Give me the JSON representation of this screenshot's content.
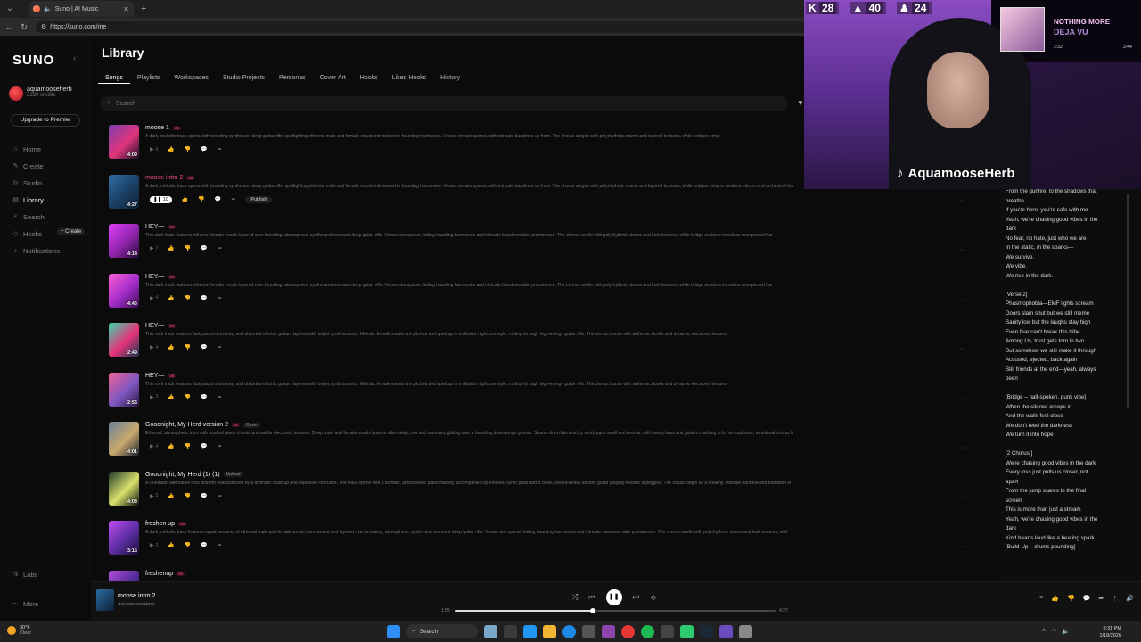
{
  "browser": {
    "tab_title": "Suno | AI Music",
    "url": "https://suno.com/me"
  },
  "sidebar": {
    "logo": "SUNO",
    "user_name": "aquamooseherb",
    "credits": "2230 credits",
    "upgrade_label": "Upgrade to Premier",
    "nav": [
      {
        "label": "Home",
        "icon": "home-icon"
      },
      {
        "label": "Create",
        "icon": "create-icon"
      },
      {
        "label": "Studio",
        "icon": "studio-icon"
      },
      {
        "label": "Library",
        "icon": "library-icon"
      },
      {
        "label": "Search",
        "icon": "search-icon"
      },
      {
        "label": "Hooks",
        "icon": "hooks-icon"
      },
      {
        "label": "Notifications",
        "icon": "bell-icon"
      }
    ],
    "create_pill": "+ Create",
    "labs": "Labs",
    "more": "More"
  },
  "library": {
    "title": "Library",
    "tabs": [
      "Songs",
      "Playlists",
      "Workspaces",
      "Studio Projects",
      "Personas",
      "Cover Art",
      "Hooks",
      "Liked Hooks",
      "History"
    ],
    "search_placeholder": "Search",
    "publish_label": "Publish",
    "songs": [
      {
        "title": "moose 1",
        "badge": "v5",
        "tag": "",
        "duration": "4:09",
        "plays": "8",
        "desc": "A dark, melodic track opens with brooding synths and deep guitar riffs, spotlighting ethereal male and female vocals intertwined in haunting harmonies. Verses remain sparse, with intricate basslines up front. The chorus surges with polyrhythmic drums and layered textures, while bridges bring",
        "colors": [
          "#7a3fb0",
          "#e0357a",
          "#1b0f2d"
        ]
      },
      {
        "title": "moose intro 2",
        "badge": "v5",
        "tag": "",
        "duration": "4:27",
        "plays": "10",
        "desc": "A dark, melodic track opens with brooding synths and deep guitar riffs, spotlighting ethereal male and female vocals intertwined in haunting harmonies. Verses remain sparse, with intricate basslines up front. The chorus surges with polyrhythmic drums and layered textures, while bridges bring in ambient electro and orchestral hits",
        "colors": [
          "#2d6da3",
          "#1b3f63",
          "#0d2034"
        ]
      },
      {
        "title": "HEY—",
        "badge": "v5",
        "tag": "",
        "duration": "4:14",
        "plays": "7",
        "desc": "This dark track features ethereal female vocals layered over brooding, atmospheric synths and resonant deep guitar riffs. Verses are sparse, letting haunting harmonies and intricate basslines take prominence. The chorus swells with polyrhythmic drums and lush textures, while bridge sections introduce unexpected har",
        "colors": [
          "#e040fb",
          "#8e24aa",
          "#2a0a3a"
        ]
      },
      {
        "title": "HEY—",
        "badge": "v5",
        "tag": "",
        "duration": "4:45",
        "plays": "4",
        "desc": "This dark track features ethereal female vocals layered over brooding, atmospheric synths and resonant deep guitar riffs. Verses are sparse, letting haunting harmonies and intricate basslines take prominence. The chorus swells with polyrhythmic drums and lush textures, while bridge sections introduce unexpected har",
        "colors": [
          "#ff5ed8",
          "#a02cc8",
          "#3a0c50"
        ]
      },
      {
        "title": "HEY—",
        "badge": "v5",
        "tag": "",
        "duration": "2:49",
        "plays": "4",
        "desc": "This rock track features fast-paced drumming and distorted electric guitars layered with bright synth accents. Melodic female vocals are pitched and sped up in a distinct nightcore style, cutting through high-energy guitar riffs. The chorus bursts with anthemic hooks and dynamic electronic textures",
        "colors": [
          "#38d9a9",
          "#e6337a",
          "#183a52"
        ]
      },
      {
        "title": "HEY—",
        "badge": "v5",
        "tag": "",
        "duration": "2:56",
        "plays": "3",
        "desc": "This rock track features fast-paced drumming and distorted electric guitars layered with bright synth accents. Melodic female vocals are pitched and sped up in a distinct nightcore style, cutting through high-energy guitar riffs. The chorus bursts with anthemic hooks and dynamic electronic textures",
        "colors": [
          "#f06292",
          "#7e57c2",
          "#2e1545"
        ]
      },
      {
        "title": "Goodnight, My Herd version 2",
        "badge": "v5",
        "tag": "Cover",
        "duration": "4:01",
        "plays": "4",
        "desc": "Ethereal, atmospheric intro with hushed piano chords and subtle electronic textures. Deep male and female vocals layer in alternately, raw and resonant, gliding over a brooding downtempo groove. Sparse drum hits and icy synth pads swell and recede, with heavy bass and guitars crashing in for an explosive, emotional chorus b",
        "colors": [
          "#6b7f9a",
          "#c9a86b",
          "#1c2434"
        ]
      },
      {
        "title": "Goodnight, My Herd (1) (1)",
        "badge": "",
        "tag": "Upload",
        "duration": "4:03",
        "plays": "5",
        "desc": "A cinematic alternative rock anthem characterized by a dramatic build-up and explosive choruses. The track opens with a somber, atmospheric piano melody accompanied by ethereal synth pads and a clean, reverb-heavy electric guitar playing melodic arpeggios. The vocals begin as a breathy, intimate baritone and transition in",
        "colors": [
          "#1d3a2a",
          "#d9e06a",
          "#0a1410"
        ]
      },
      {
        "title": "freshen up",
        "badge": "v5",
        "tag": "",
        "duration": "3:15",
        "plays": "2",
        "desc": "A dark, melodic track features equal amounts of ethereal male and female vocals harmonized and layered over brooding, atmospheric synths and resonant deep guitar riffs. Verses are sparse, letting haunting harmonies and intricate basslines take prominence. The chorus swells with polyrhythmic drums and lush textures, whil",
        "colors": [
          "#c04cf0",
          "#5a2da0",
          "#1c0c35"
        ]
      },
      {
        "title": "freshenup",
        "badge": "v5",
        "tag": "",
        "duration": "",
        "plays": "",
        "desc": "",
        "colors": [
          "#b44ce0",
          "#4a2a90",
          "#150a2a"
        ]
      }
    ]
  },
  "lyrics": "From the gunfire, to the shadows that\nbreathe\nIf you're here, you're safe with me\nYeah, we're chasing good vibes in the\ndark\nNo fear, no hate, just who we are\nIn the static, in the sparks—\nWe survive.\nWe vibe.\nWe rise in the dark.\n\n[Verse 2]\nPhasmophobia—EMF lights scream\nDoors slam shut but we still meme\nSanity low but the laughs stay high\nEven fear can't break this tribe\nAmong Us, trust gets torn in two\nBut somehow we still make it through\nAccused, ejected, back again\nStill friends at the end—yeah, always\nbeen\n\n[Bridge – half-spoken, punk vibe]\nWhen the silence creeps in\nAnd the walls feel close\nWe don't feed the darkness\nWe turn it into hope\n\n[2 Chorus ]\nWe're chasing good vibes in the dark\nEvery loss just pulls us closer, not\napart\nFrom the jump scares to the final\nscreen\nThis is more than just a stream\nYeah, we're chasing good vibes in the\ndark\nKind hearts loud like a beating spark\n[Build-Up – drums pounding]",
  "stream": {
    "stat1": "28",
    "stat2": "40",
    "stat3": "24",
    "np_title": "NOTHING MORE",
    "np_sub": "DEJA VU",
    "np_elapsed": "2:32",
    "np_total": "3:44",
    "handle": "AquamooseHerb"
  },
  "player": {
    "title": "moose intro 2",
    "artist": "AquamooseHerb",
    "elapsed": "1:55",
    "total": "4:27",
    "progress": 0.43
  },
  "taskbar": {
    "temp": "30°F",
    "condition": "Clear",
    "search": "Search",
    "time": "8:31 PM",
    "date": "1/18/2026"
  }
}
